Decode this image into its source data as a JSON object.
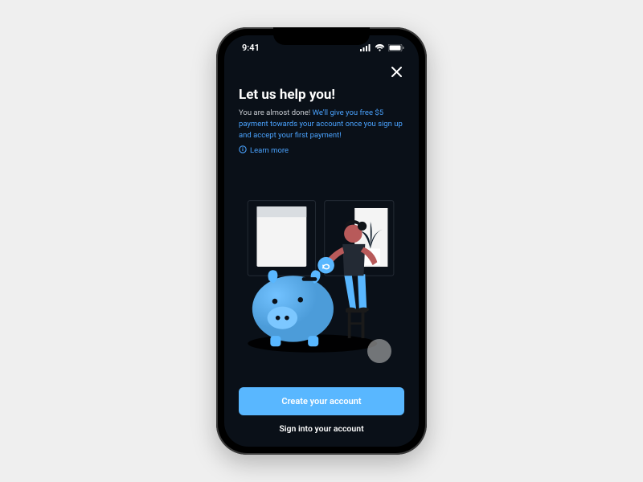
{
  "status": {
    "time": "9:41"
  },
  "modal": {
    "title": "Let us help you!",
    "subtitle_prefix": "You are almost done! ",
    "subtitle_highlight": "We'll give you free $5 payment towards your account once you sign up and accept your first payment!",
    "learn_more": "Learn more"
  },
  "buttons": {
    "primary": "Create your account",
    "secondary": "Sign into your account"
  },
  "colors": {
    "accent": "#59b7ff",
    "link": "#4aa3ff",
    "bg": "#0a1018"
  },
  "icons": {
    "close": "close-icon",
    "info": "info-circle-icon",
    "signal": "cellular-signal-icon",
    "wifi": "wifi-icon",
    "battery": "battery-icon"
  }
}
